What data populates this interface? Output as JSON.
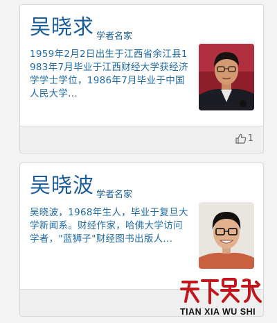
{
  "cards": [
    {
      "name": "吴晓求",
      "tag": "学者名家",
      "description": "1959年2月2日出生于江西省余江县1983年7月毕业于江西财经大学获经济学学士学位，1986年7月毕业于中国人民大学...",
      "photo_alt": "吴晓求",
      "likes": "1"
    },
    {
      "name": "吴晓波",
      "tag": "学者名家",
      "description": "吴晓波，1968年生人，毕业于复旦大学新闻系。财经作家，哈佛大学访问学者，\"蓝狮子\"财经图书出版人...",
      "photo_alt": "吴晓波",
      "likes": ""
    }
  ],
  "watermark": {
    "calligraphy": "天下吴氏",
    "latin": "TIAN XIA WU SHI"
  },
  "colors": {
    "link_blue": "#1a5d9a",
    "card_bg": "#ffffff",
    "footer_bg": "#efefef",
    "watermark_red": "#c0161c"
  }
}
